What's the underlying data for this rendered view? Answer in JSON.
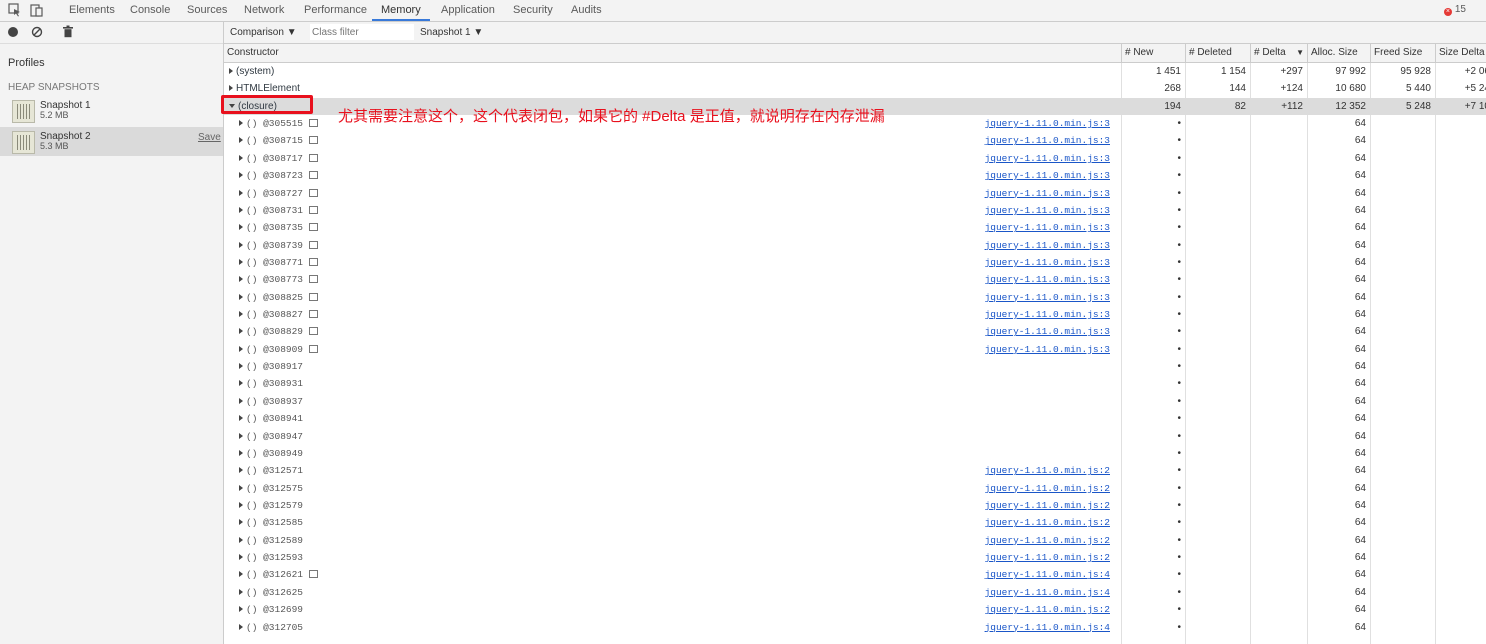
{
  "tabs": [
    "Elements",
    "Console",
    "Sources",
    "Network",
    "Performance",
    "Memory",
    "Application",
    "Security",
    "Audits"
  ],
  "active_tab": "Memory",
  "error_count": "15",
  "sidebar": {
    "title": "Profiles",
    "section": "HEAP SNAPSHOTS",
    "snapshots": [
      {
        "name": "Snapshot 1",
        "size": "5.2 MB"
      },
      {
        "name": "Snapshot 2",
        "size": "5.3 MB",
        "action": "Save"
      }
    ]
  },
  "toolbar": {
    "view": "Comparison",
    "filter_placeholder": "Class filter",
    "base_snapshot": "Snapshot 1"
  },
  "columns": [
    "Constructor",
    "# New",
    "# Deleted",
    "# Delta",
    "Alloc. Size",
    "Freed Size",
    "Size Delta"
  ],
  "summary_rows": [
    {
      "name": "(system)",
      "new": "1 451",
      "deleted": "1 154",
      "delta": "+297",
      "alloc": "97 992",
      "freed": "95 928",
      "sdelta": "+2 06"
    },
    {
      "name": "HTMLElement",
      "new": "268",
      "deleted": "144",
      "delta": "+124",
      "alloc": "10 680",
      "freed": "5 440",
      "sdelta": "+5 24"
    },
    {
      "name": "(closure)",
      "new": "194",
      "deleted": "82",
      "delta": "+112",
      "alloc": "12 352",
      "freed": "5 248",
      "sdelta": "+7 10"
    }
  ],
  "closure_rows": [
    {
      "id": "() @305515",
      "box": true,
      "src": "jquery-1.11.0.min.js:3",
      "new": "•",
      "alloc": "64"
    },
    {
      "id": "() @308715",
      "box": true,
      "src": "jquery-1.11.0.min.js:3",
      "new": "•",
      "alloc": "64"
    },
    {
      "id": "() @308717",
      "box": true,
      "src": "jquery-1.11.0.min.js:3",
      "new": "•",
      "alloc": "64"
    },
    {
      "id": "() @308723",
      "box": true,
      "src": "jquery-1.11.0.min.js:3",
      "new": "•",
      "alloc": "64"
    },
    {
      "id": "() @308727",
      "box": true,
      "src": "jquery-1.11.0.min.js:3",
      "new": "•",
      "alloc": "64"
    },
    {
      "id": "() @308731",
      "box": true,
      "src": "jquery-1.11.0.min.js:3",
      "new": "•",
      "alloc": "64"
    },
    {
      "id": "() @308735",
      "box": true,
      "src": "jquery-1.11.0.min.js:3",
      "new": "•",
      "alloc": "64"
    },
    {
      "id": "() @308739",
      "box": true,
      "src": "jquery-1.11.0.min.js:3",
      "new": "•",
      "alloc": "64"
    },
    {
      "id": "() @308771",
      "box": true,
      "src": "jquery-1.11.0.min.js:3",
      "new": "•",
      "alloc": "64"
    },
    {
      "id": "() @308773",
      "box": true,
      "src": "jquery-1.11.0.min.js:3",
      "new": "•",
      "alloc": "64"
    },
    {
      "id": "() @308825",
      "box": true,
      "src": "jquery-1.11.0.min.js:3",
      "new": "•",
      "alloc": "64"
    },
    {
      "id": "() @308827",
      "box": true,
      "src": "jquery-1.11.0.min.js:3",
      "new": "•",
      "alloc": "64"
    },
    {
      "id": "() @308829",
      "box": true,
      "src": "jquery-1.11.0.min.js:3",
      "new": "•",
      "alloc": "64"
    },
    {
      "id": "() @308909",
      "box": true,
      "src": "jquery-1.11.0.min.js:3",
      "new": "•",
      "alloc": "64"
    },
    {
      "id": "() @308917",
      "box": false,
      "src": "",
      "new": "•",
      "alloc": "64"
    },
    {
      "id": "() @308931",
      "box": false,
      "src": "",
      "new": "•",
      "alloc": "64"
    },
    {
      "id": "() @308937",
      "box": false,
      "src": "",
      "new": "•",
      "alloc": "64"
    },
    {
      "id": "() @308941",
      "box": false,
      "src": "",
      "new": "•",
      "alloc": "64"
    },
    {
      "id": "() @308947",
      "box": false,
      "src": "",
      "new": "•",
      "alloc": "64"
    },
    {
      "id": "() @308949",
      "box": false,
      "src": "",
      "new": "•",
      "alloc": "64"
    },
    {
      "id": "() @312571",
      "box": false,
      "src": "jquery-1.11.0.min.js:2",
      "new": "•",
      "alloc": "64"
    },
    {
      "id": "() @312575",
      "box": false,
      "src": "jquery-1.11.0.min.js:2",
      "new": "•",
      "alloc": "64"
    },
    {
      "id": "() @312579",
      "box": false,
      "src": "jquery-1.11.0.min.js:2",
      "new": "•",
      "alloc": "64"
    },
    {
      "id": "() @312585",
      "box": false,
      "src": "jquery-1.11.0.min.js:2",
      "new": "•",
      "alloc": "64"
    },
    {
      "id": "() @312589",
      "box": false,
      "src": "jquery-1.11.0.min.js:2",
      "new": "•",
      "alloc": "64"
    },
    {
      "id": "() @312593",
      "box": false,
      "src": "jquery-1.11.0.min.js:2",
      "new": "•",
      "alloc": "64"
    },
    {
      "id": "() @312621",
      "box": true,
      "src": "jquery-1.11.0.min.js:4",
      "new": "•",
      "alloc": "64"
    },
    {
      "id": "() @312625",
      "box": false,
      "src": "jquery-1.11.0.min.js:4",
      "new": "•",
      "alloc": "64"
    },
    {
      "id": "() @312699",
      "box": false,
      "src": "jquery-1.11.0.min.js:2",
      "new": "•",
      "alloc": "64"
    },
    {
      "id": "() @312705",
      "box": false,
      "src": "jquery-1.11.0.min.js:4",
      "new": "•",
      "alloc": "64"
    }
  ],
  "annotation": "尤其需要注意这个，这个代表闭包，如果它的 #Delta 是正值，就说明存在内存泄漏"
}
